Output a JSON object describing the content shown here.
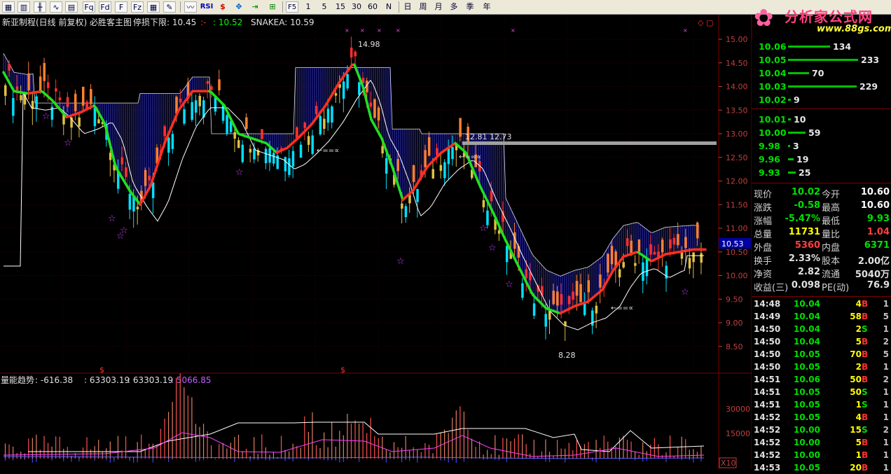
{
  "toolbar": {
    "rsi": "RSI",
    "f5": "F5",
    "periods": [
      "1",
      "5",
      "15",
      "30",
      "60",
      "N"
    ],
    "ranges": [
      "日",
      "周",
      "月",
      "多",
      "季",
      "年"
    ],
    "icons": [
      "app-icon",
      "bar-icon",
      "candle-icon",
      "line-icon",
      "fq-icon",
      "fd-icon",
      "f10-icon",
      "fz-icon",
      "draw-icon",
      "indicator-icon",
      "money-icon",
      "cross-icon",
      "export-icon",
      "import-icon"
    ]
  },
  "logo": {
    "text": "分析家公式网",
    "url": "www.88gs.com"
  },
  "main_header": {
    "title": "新亚制程(日线 前复权) 必胜客主图",
    "stop_label": "停损下限: 10.45",
    "dash": ":-",
    "value2": ": 10.52",
    "snake": "SNAKEA: 10.59"
  },
  "price_annotations": {
    "high": "14.98",
    "mid": "12.81 12.73",
    "low": "8.28",
    "current": "10.53"
  },
  "price_axis": {
    "ticks": [
      "15.00",
      "14.50",
      "14.00",
      "13.50",
      "13.00",
      "12.50",
      "12.00",
      "11.50",
      "11.00",
      "10.50",
      "10.00",
      "9.50",
      "9.00",
      "8.50"
    ]
  },
  "volume_header": {
    "name": "量能趋势",
    "v1": ": -616.38",
    "v2": ": 63303.19",
    "v3": ": 63303.19",
    "v4": ": 5066.85"
  },
  "volume_axis": {
    "ticks": [
      "30000",
      "15000"
    ],
    "unit": "X10"
  },
  "order_book": {
    "asks": [
      {
        "p": "10.06",
        "v": "134",
        "f": 0.6
      },
      {
        "p": "10.05",
        "v": "233",
        "f": 1.0
      },
      {
        "p": "10.04",
        "v": "70",
        "f": 0.3
      },
      {
        "p": "10.03",
        "v": "229",
        "f": 0.98
      },
      {
        "p": "10.02",
        "v": "9",
        "f": 0.04
      }
    ],
    "bids": [
      {
        "p": "10.01",
        "v": "10",
        "f": 0.04
      },
      {
        "p": "10.00",
        "v": "59",
        "f": 0.25
      },
      {
        "p": "9.98",
        "v": "3",
        "f": 0.01
      },
      {
        "p": "9.96",
        "v": "19",
        "f": 0.08
      },
      {
        "p": "9.93",
        "v": "25",
        "f": 0.11
      }
    ]
  },
  "quote": {
    "rows": [
      {
        "l1": "现价",
        "v1": "10.02",
        "c1": "#00e000",
        "l2": "今开",
        "v2": "10.60",
        "c2": "#ffffff"
      },
      {
        "l1": "涨跌",
        "v1": "-0.58",
        "c1": "#00e000",
        "l2": "最高",
        "v2": "10.60",
        "c2": "#ffffff"
      },
      {
        "l1": "涨幅",
        "v1": "-5.47%",
        "c1": "#00e000",
        "l2": "最低",
        "v2": "9.93",
        "c2": "#00e000"
      },
      {
        "l1": "总量",
        "v1": "11731",
        "c1": "#ffff00",
        "l2": "量比",
        "v2": "1.04",
        "c2": "#ff4040"
      },
      {
        "l1": "外盘",
        "v1": "5360",
        "c1": "#ff4040",
        "l2": "内盘",
        "v2": "6371",
        "c2": "#00e000"
      },
      {
        "l1": "换手",
        "v1": "2.33%",
        "c1": "#e0e0e0",
        "l2": "股本",
        "v2": "2.00亿",
        "c2": "#e0e0e0"
      },
      {
        "l1": "净资",
        "v1": "2.82",
        "c1": "#e0e0e0",
        "l2": "流通",
        "v2": "5040万",
        "c2": "#e0e0e0"
      },
      {
        "l1": "收益(三)",
        "v1": "0.098",
        "c1": "#e0e0e0",
        "l2": "PE(动)",
        "v2": "76.9",
        "c2": "#e0e0e0"
      }
    ]
  },
  "ticks": [
    {
      "t": "14:48",
      "p": "10.04",
      "v": "4",
      "s": "B",
      "n": "1"
    },
    {
      "t": "14:49",
      "p": "10.04",
      "v": "58",
      "s": "B",
      "n": "5"
    },
    {
      "t": "14:50",
      "p": "10.04",
      "v": "2",
      "s": "S",
      "n": "1"
    },
    {
      "t": "14:50",
      "p": "10.04",
      "v": "5",
      "s": "B",
      "n": "2"
    },
    {
      "t": "14:50",
      "p": "10.05",
      "v": "70",
      "s": "B",
      "n": "5"
    },
    {
      "t": "14:50",
      "p": "10.05",
      "v": "2",
      "s": "B",
      "n": "1"
    },
    {
      "t": "14:51",
      "p": "10.06",
      "v": "50",
      "s": "B",
      "n": "2"
    },
    {
      "t": "14:51",
      "p": "10.05",
      "v": "50",
      "s": "S",
      "n": "1"
    },
    {
      "t": "14:51",
      "p": "10.05",
      "v": "1",
      "s": "S",
      "n": "1"
    },
    {
      "t": "14:52",
      "p": "10.05",
      "v": "4",
      "s": "B",
      "n": "1"
    },
    {
      "t": "14:52",
      "p": "10.00",
      "v": "15",
      "s": "S",
      "n": "2"
    },
    {
      "t": "14:52",
      "p": "10.00",
      "v": "5",
      "s": "B",
      "n": "1"
    },
    {
      "t": "14:52",
      "p": "10.00",
      "v": "1",
      "s": "B",
      "n": "1"
    },
    {
      "t": "14:53",
      "p": "10.05",
      "v": "20",
      "s": "B",
      "n": "1"
    }
  ],
  "colors": {
    "up": "#ff3030",
    "down": "#00ffff",
    "green_ma": "#00e000",
    "grid": "#800000"
  }
}
